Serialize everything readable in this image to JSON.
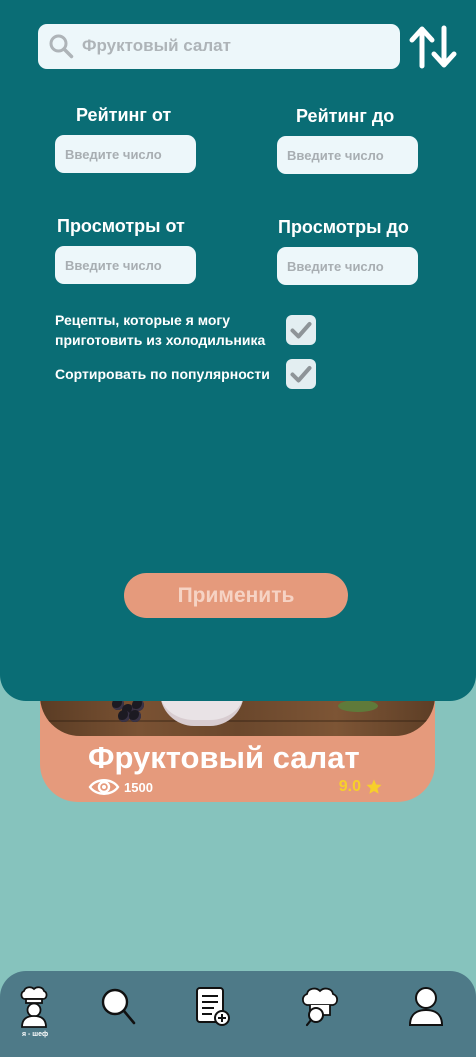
{
  "search": {
    "value": "Фруктовый салат"
  },
  "filters": {
    "rating_from_label": "Рейтинг от",
    "rating_to_label": "Рейтинг до",
    "views_from_label": "Просмотры от",
    "views_to_label": "Просмотры до",
    "input_placeholder": "Введите число",
    "fridge_option": {
      "label_line1": "Рецепты, которые я могу",
      "label_line2": "приготовить из холодильника",
      "checked": true
    },
    "popular_option": {
      "label": "Сортировать по популярности",
      "checked": true
    },
    "apply_label": "Применить"
  },
  "recipe": {
    "title": "Фруктовый салат",
    "views": "1500",
    "rating": "9.0"
  },
  "nav": {
    "items": [
      {
        "icon": "chef-icon",
        "caption": "я - шеф"
      },
      {
        "icon": "search-icon"
      },
      {
        "icon": "add-recipe-icon"
      },
      {
        "icon": "chef-search-icon"
      },
      {
        "icon": "profile-icon"
      }
    ]
  },
  "colors": {
    "panel": "#0a6d75",
    "background": "#86c3bd",
    "accent": "#e59a7c",
    "nav": "#4e7a88",
    "rating": "#f7cf2a"
  }
}
